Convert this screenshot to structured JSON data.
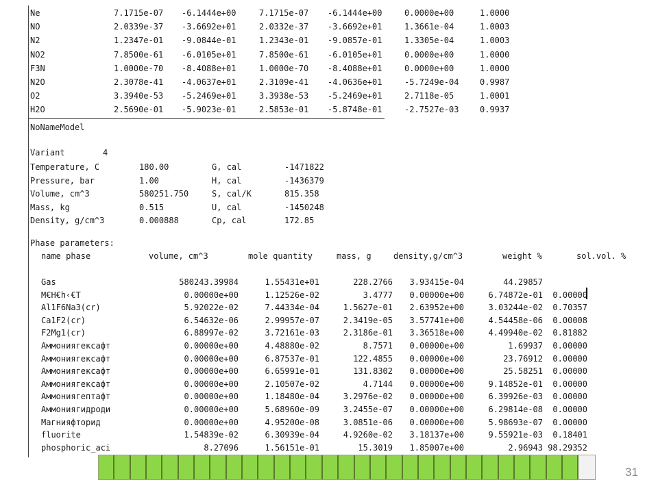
{
  "species_rows": [
    [
      "Ne",
      "7.1715e-07",
      "-6.1444e+00",
      "7.1715e-07",
      "-6.1444e+00",
      "0.0000e+00",
      "1.0000"
    ],
    [
      "NO",
      "2.0339e-37",
      "-3.6692e+01",
      "2.0332e-37",
      "-3.6692e+01",
      "1.3661e-04",
      "1.0003"
    ],
    [
      "N2",
      "1.2347e-01",
      "-9.0844e-01",
      "1.2343e-01",
      "-9.0857e-01",
      "1.3305e-04",
      "1.0003"
    ],
    [
      "NO2",
      "7.8500e-61",
      "-6.0105e+01",
      "7.8500e-61",
      "-6.0105e+01",
      "0.0000e+00",
      "1.0000"
    ],
    [
      "F3N",
      "1.0000e-70",
      "-8.4088e+01",
      "1.0000e-70",
      "-8.4088e+01",
      "0.0000e+00",
      "1.0000"
    ],
    [
      "N2O",
      "2.3078e-41",
      "-4.0637e+01",
      "2.3109e-41",
      "-4.0636e+01",
      "-5.7249e-04",
      "0.9987"
    ],
    [
      "O2",
      "3.3940e-53",
      "-5.2469e+01",
      "3.3938e-53",
      "-5.2469e+01",
      "2.7118e-05",
      "1.0001"
    ],
    [
      "H2O",
      "2.5690e-01",
      "-5.9023e-01",
      "2.5853e-01",
      "-5.8748e-01",
      "-2.7527e-03",
      "0.9937"
    ]
  ],
  "model_name": "NoNameModel",
  "variant": {
    "label": "Variant",
    "value": "4"
  },
  "props": [
    [
      "Temperature, C",
      "180.00",
      "G, cal",
      "-1471822"
    ],
    [
      "Pressure, bar",
      "1.00",
      "H, cal",
      "-1436379"
    ],
    [
      "Volume, cm^3",
      "580251.750",
      "S, cal/K",
      "815.358"
    ],
    [
      "Mass, kg",
      "0.515",
      "U, cal",
      "-1450248"
    ],
    [
      "Density, g/cm^3",
      "0.000888",
      "Cp, cal",
      "172.85"
    ]
  ],
  "phase_title": "Phase parameters:",
  "phase_headers": [
    "name phase",
    "volume, cm^3",
    "mole quantity",
    "mass, g",
    "density,g/cm^3",
    "weight %",
    "sol.vol. %"
  ],
  "phases": [
    [
      "Gas",
      "580243.39984",
      "1.55431e+01",
      "228.2766",
      "3.93415e-04",
      "44.29857",
      ""
    ],
    [
      "M€H€h‹€T",
      "0.00000e+00",
      "1.12526e-02",
      "3.4777",
      "0.00000e+00",
      "6.74872e-01",
      "0.00000"
    ],
    [
      "Al1F6Na3(cr)",
      "5.92022e-02",
      "7.44334e-04",
      "1.5627e-01",
      "2.63952e+00",
      "3.03244e-02",
      "0.70357"
    ],
    [
      "Ca1F2(cr)",
      "6.54632e-06",
      "2.99957e-07",
      "2.3419e-05",
      "3.57741e+00",
      "4.54458e-06",
      "0.00008"
    ],
    [
      "F2Mg1(cr)",
      "6.88997e-02",
      "3.72161e-03",
      "2.3186e-01",
      "3.36518e+00",
      "4.49940e-02",
      "0.81882"
    ],
    [
      "Аммониягексафт",
      "0.00000e+00",
      "4.48880e-02",
      "8.7571",
      "0.00000e+00",
      "1.69937",
      "0.00000"
    ],
    [
      "Аммониягексафт",
      "0.00000e+00",
      "6.87537e-01",
      "122.4855",
      "0.00000e+00",
      "23.76912",
      "0.00000"
    ],
    [
      "Аммониягексафт",
      "0.00000e+00",
      "6.65991e-01",
      "131.8302",
      "0.00000e+00",
      "25.58251",
      "0.00000"
    ],
    [
      "Аммониягексафт",
      "0.00000e+00",
      "2.10507e-02",
      "4.7144",
      "0.00000e+00",
      "9.14852e-01",
      "0.00000"
    ],
    [
      "Аммониягептафт",
      "0.00000e+00",
      "1.18480e-04",
      "3.2976e-02",
      "0.00000e+00",
      "6.39926e-03",
      "0.00000"
    ],
    [
      "Аммониягидроди",
      "0.00000e+00",
      "5.68960e-09",
      "3.2455e-07",
      "0.00000e+00",
      "6.29814e-08",
      "0.00000"
    ],
    [
      "Магнияфторид",
      "0.00000e+00",
      "4.95200e-08",
      "3.0851e-06",
      "0.00000e+00",
      "5.98693e-07",
      "0.00000"
    ],
    [
      "fluorite",
      "1.54839e-02",
      "6.30939e-04",
      "4.9260e-02",
      "3.18137e+00",
      "9.55921e-03",
      "0.18401"
    ],
    [
      "phosphoric_aci",
      "8.27096",
      "1.56151e-01",
      "15.3019",
      "1.85007e+00",
      "2.96943",
      "98.29352"
    ]
  ],
  "progress": {
    "total_segments": 31,
    "filled_segments": 30
  },
  "colors": {
    "progress_fill": "#8cd647",
    "progress_divider": "#5b7a2a",
    "page_number": "#8a8a8a"
  },
  "page_number": "31"
}
